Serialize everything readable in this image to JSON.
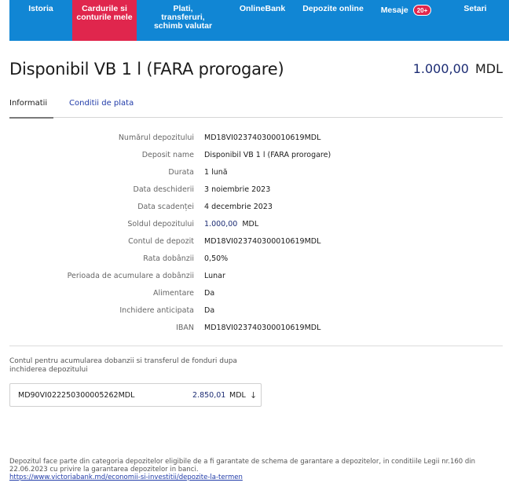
{
  "nav": {
    "items": [
      {
        "label": "Istoria"
      },
      {
        "label": "Cardurile si\nconturile mele"
      },
      {
        "label": "Plati,\ntransferuri,\nschimb valutar"
      },
      {
        "label": "OnlineBank"
      },
      {
        "label": "Depozite online"
      },
      {
        "label": "Mesaje"
      },
      {
        "label": "Setari"
      }
    ],
    "badge": "20+"
  },
  "header": {
    "title": "Disponibil VB 1 l (FARA prorogare)",
    "balance": "1.000,00",
    "currency": "MDL"
  },
  "tabs": [
    {
      "label": "Informatii"
    },
    {
      "label": "Conditii de plata"
    }
  ],
  "details": [
    {
      "label": "Numărul depozitului",
      "value": "MD18VI023740300010619MDL"
    },
    {
      "label": "Deposit name",
      "value": "Disponibil VB 1 l (FARA prorogare)"
    },
    {
      "label": "Durata",
      "value": "1 lună"
    },
    {
      "label": "Data deschiderii",
      "value": "3 noiembrie 2023"
    },
    {
      "label": "Data scadenței",
      "value": "4 decembrie 2023"
    },
    {
      "label": "Soldul depozitului",
      "value": "1.000,00",
      "currency": "MDL"
    },
    {
      "label": "Contul de depozit",
      "value": "MD18VI023740300010619MDL"
    },
    {
      "label": "Rata dobânzii",
      "value": "0,50%"
    },
    {
      "label": "Perioada de acumulare a dobânzii",
      "value": "Lunar"
    },
    {
      "label": "Alimentare",
      "value": "Da"
    },
    {
      "label": "Inchidere anticipata",
      "value": "Da"
    },
    {
      "label": "IBAN",
      "value": "MD18VI023740300010619MDL"
    }
  ],
  "interest_account": {
    "caption": "Contul pentru acumularea dobanzii si transferul de fonduri dupa inchiderea depozitului",
    "number": "MD90VI022250300005262MDL",
    "amount": "2.850,01",
    "currency": "MDL",
    "arrow": "↓"
  },
  "footnote": {
    "text": "Depozitul face parte din categoria depozitelor eligibile de a fi garantate de schema de garantare a depozitelor, in conditiile Legii nr.160 din 22.06.2023 cu privire la garantarea depozitelor in banci.",
    "link": "https://www.victoriabank.md/economii-si-investitii/depozite-la-termen"
  },
  "colors": {
    "nav_bg": "#1186d4",
    "nav_active": "#e0264d",
    "accent_text": "#1c2c74",
    "link": "#1f3aa8"
  }
}
